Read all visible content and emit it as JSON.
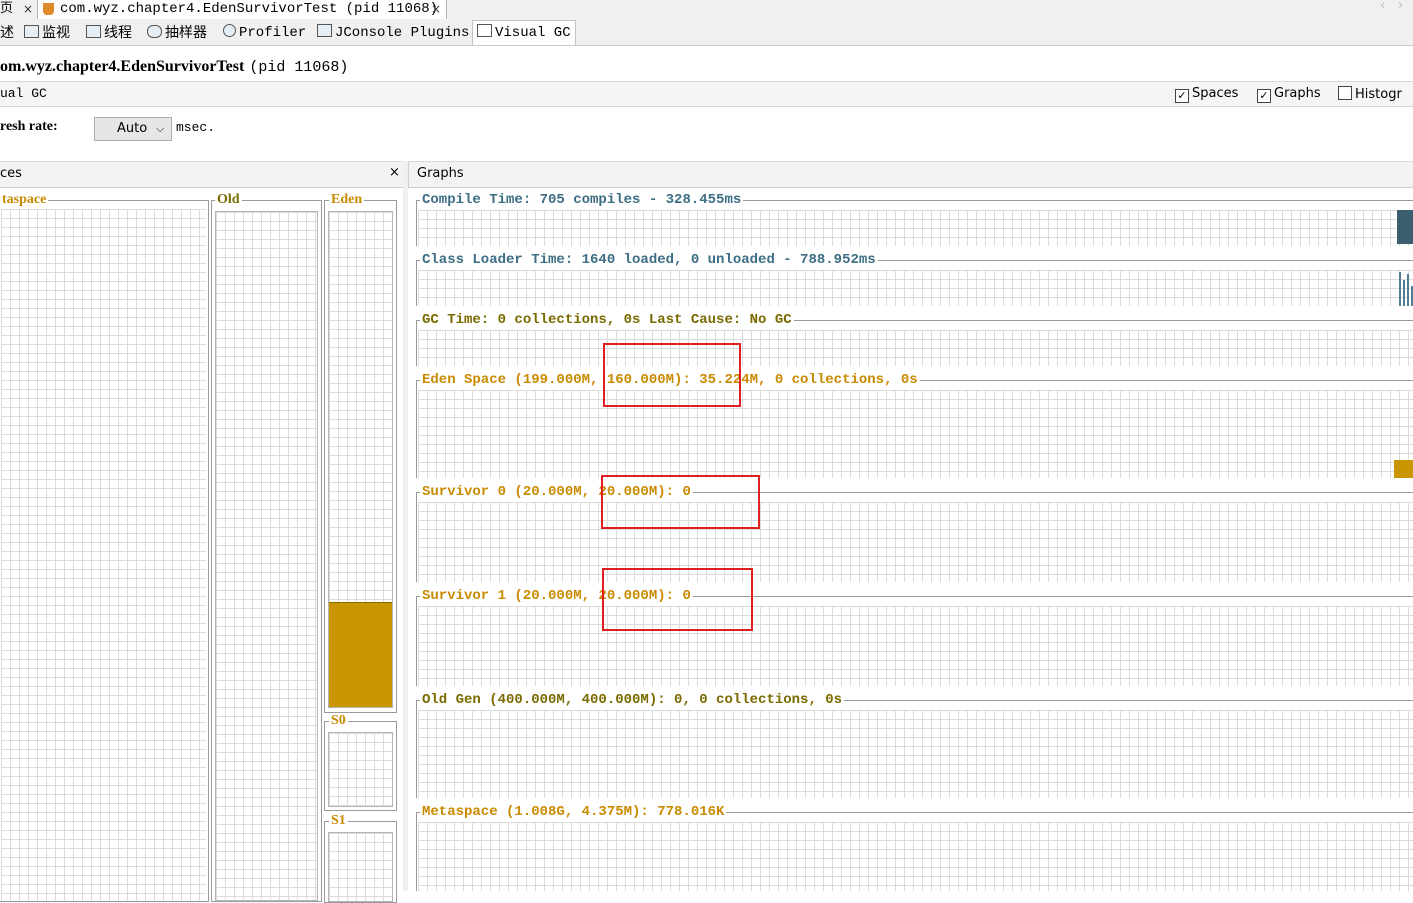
{
  "doc_tabs": [
    {
      "label": "页",
      "close": "×"
    },
    {
      "label": "com.wyz.chapter4.EdenSurvivorTest (pid 11068)",
      "close": "×",
      "icon": "java-cup-icon"
    }
  ],
  "sub_tabs": [
    {
      "label": "述",
      "icon": "overview-icon"
    },
    {
      "label": "监视",
      "icon": "monitor-icon"
    },
    {
      "label": "线程",
      "icon": "threads-icon"
    },
    {
      "label": "抽样器",
      "icon": "sampler-icon"
    },
    {
      "label": "Profiler",
      "icon": "profiler-icon"
    },
    {
      "label": "JConsole Plugins",
      "icon": "jconsole-icon"
    },
    {
      "label": "Visual GC",
      "icon": "visualgc-icon",
      "active": true
    }
  ],
  "process_title": {
    "name": "om.wyz.chapter4.EdenSurvivorTest",
    "pid": "(pid 11068)"
  },
  "vgc_bar": {
    "title": "ual GC",
    "checkboxes": [
      {
        "label": "Spaces",
        "checked": true,
        "mark": "✓"
      },
      {
        "label": "Graphs",
        "checked": true,
        "mark": "✓"
      },
      {
        "label": "Histogr",
        "checked": false,
        "mark": ""
      }
    ]
  },
  "refresh": {
    "label": "resh rate:",
    "value": "Auto",
    "unit": "msec."
  },
  "spaces_panel": {
    "title": "ces",
    "close": "×",
    "metaspace": "taspace",
    "old": "Old",
    "eden": "Eden",
    "s0": "S0",
    "s1": "S1",
    "eden_fill_fraction": 0.21
  },
  "graphs_panel": {
    "title": "Graphs",
    "graphs": [
      {
        "title": "Compile Time: 705 compiles - 328.455ms"
      },
      {
        "title": "Class Loader Time: 1640 loaded, 0 unloaded - 788.952ms"
      },
      {
        "title": "GC Time: 0 collections, 0s Last Cause: No GC"
      },
      {
        "title": "Eden Space (199.000M, 160.000M): 35.224M, 0 collections, 0s"
      },
      {
        "title": "Survivor 0 (20.000M, 20.000M): 0"
      },
      {
        "title": "Survivor 1 (20.000M, 20.000M): 0"
      },
      {
        "title": "Old Gen (400.000M, 400.000M): 0, 0 collections, 0s"
      },
      {
        "title": "Metaspace (1.008G, 4.375M): 778.016K"
      }
    ]
  },
  "colors": {
    "orange": "#c98a00",
    "teal": "#3c6e84",
    "eden_fill": "#c99500",
    "compile_fill": "#3c5f70",
    "highlight": "#e02020"
  }
}
